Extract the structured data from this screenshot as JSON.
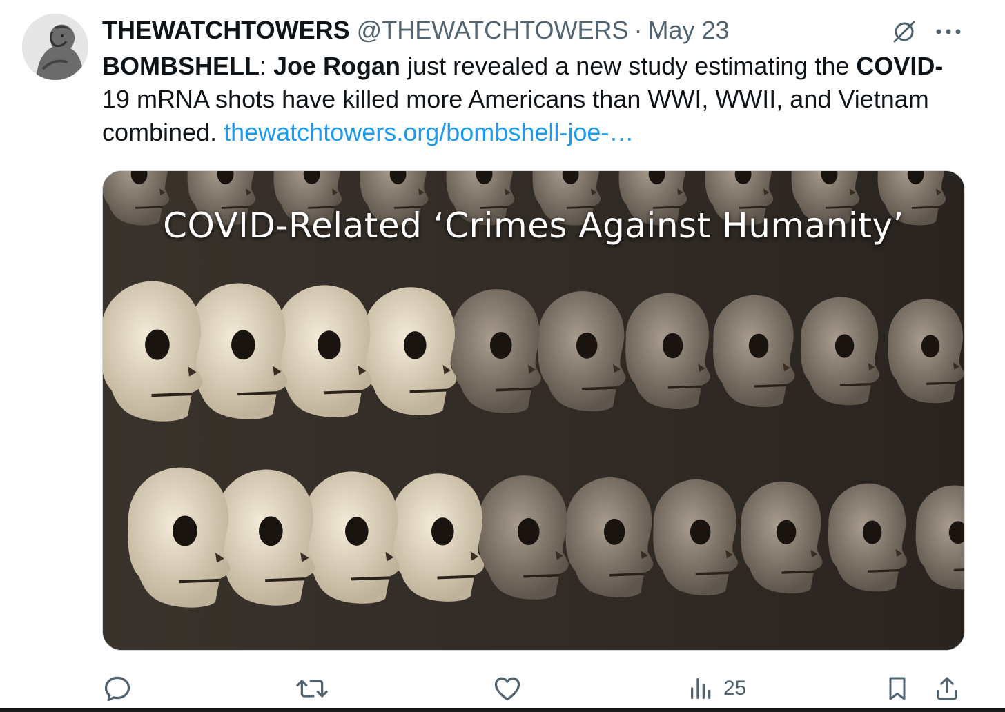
{
  "author": {
    "display_name": "THEWATCHTOWERS",
    "handle": "@THEWATCHTOWERS",
    "separator": "·",
    "date": "May 23"
  },
  "tweet": {
    "bold_1": "BOMBSHELL",
    "text_1": ": ",
    "bold_2": "Joe Rogan",
    "text_2": " just revealed a new study estimating the ",
    "bold_3": "COVID-",
    "text_3": "19 mRNA shots have killed more Americans than WWI, WWII, and Vietnam combined. ",
    "link": "thewatchtowers.org/bombshell-joe-…"
  },
  "media": {
    "caption": "COVID-Related ‘Crimes Against Humanity’"
  },
  "actions": {
    "reply_icon": "reply-icon",
    "retweet_icon": "retweet-icon",
    "like_icon": "heart-icon",
    "views_icon": "views-icon",
    "views_count": "25",
    "bookmark_icon": "bookmark-icon",
    "share_icon": "share-icon"
  },
  "colors": {
    "link": "#1d9bf0",
    "muted": "#536471",
    "text": "#0f1419"
  }
}
